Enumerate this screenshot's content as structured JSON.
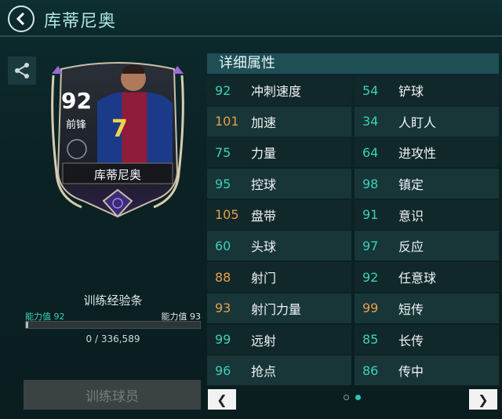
{
  "header": {
    "title": "库蒂尼奥"
  },
  "colors": {
    "teal": "#3ad1b8",
    "orange": "#e6a04a",
    "accent": "#2cc6b5"
  },
  "card": {
    "rating": "92",
    "position": "前锋",
    "name": "库蒂尼奥",
    "jersey": "7"
  },
  "training": {
    "label": "训练经验条",
    "current_label": "能力值 92",
    "next_label": "能力值 93",
    "progress_text": "0 / 336,589",
    "progress_fraction": 0,
    "button": "训练球员"
  },
  "attributes": {
    "title": "详细属性",
    "rows": [
      [
        {
          "value": "92",
          "name": "冲刺速度",
          "tone": "teal"
        },
        {
          "value": "54",
          "name": "铲球",
          "tone": "teal"
        }
      ],
      [
        {
          "value": "101",
          "name": "加速",
          "tone": "orange"
        },
        {
          "value": "34",
          "name": "人盯人",
          "tone": "teal"
        }
      ],
      [
        {
          "value": "75",
          "name": "力量",
          "tone": "teal"
        },
        {
          "value": "64",
          "name": "进攻性",
          "tone": "teal"
        }
      ],
      [
        {
          "value": "95",
          "name": "控球",
          "tone": "teal"
        },
        {
          "value": "98",
          "name": "镇定",
          "tone": "teal"
        }
      ],
      [
        {
          "value": "105",
          "name": "盘带",
          "tone": "orange"
        },
        {
          "value": "91",
          "name": "意识",
          "tone": "teal"
        }
      ],
      [
        {
          "value": "60",
          "name": "头球",
          "tone": "teal"
        },
        {
          "value": "97",
          "name": "反应",
          "tone": "teal"
        }
      ],
      [
        {
          "value": "88",
          "name": "射门",
          "tone": "orange"
        },
        {
          "value": "92",
          "name": "任意球",
          "tone": "teal"
        }
      ],
      [
        {
          "value": "93",
          "name": "射门力量",
          "tone": "orange"
        },
        {
          "value": "99",
          "name": "短传",
          "tone": "orange"
        }
      ],
      [
        {
          "value": "99",
          "name": "远射",
          "tone": "teal"
        },
        {
          "value": "85",
          "name": "长传",
          "tone": "teal"
        }
      ],
      [
        {
          "value": "96",
          "name": "抢点",
          "tone": "teal"
        },
        {
          "value": "86",
          "name": "传中",
          "tone": "teal"
        }
      ]
    ]
  },
  "pager": {
    "prev_icon": "chevron-left-icon",
    "next_icon": "chevron-right-icon",
    "pages": 2,
    "active_page": 2
  }
}
